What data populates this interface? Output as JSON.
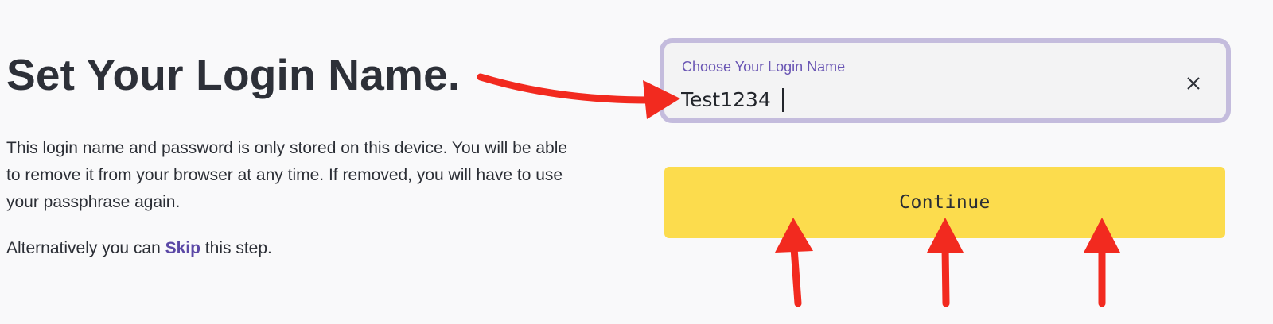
{
  "page": {
    "title": "Set Your Login Name.",
    "description": "This login name and password is only stored on this device. You will be able to remove it from your browser at any time. If removed, you will have to use your passphrase again.",
    "alternative": {
      "prefix": "Alternatively you can ",
      "link_label": "Skip",
      "suffix": " this step."
    }
  },
  "login_field": {
    "label": "Choose Your Login Name",
    "value": "Test1234",
    "clear_icon": "close-icon"
  },
  "continue_button": {
    "label": "Continue"
  },
  "annotations": {
    "arrow_color": "#f22a1f",
    "arrows": [
      "arrow-pointing-to-input",
      "arrow-pointing-to-continue-left",
      "arrow-pointing-to-continue-center",
      "arrow-pointing-to-continue-right"
    ]
  },
  "colors": {
    "background": "#f9f9fa",
    "accent": "#6a56b4",
    "link": "#5b48a6",
    "field_border": "#c4bcdd",
    "button": "#fcdc4d",
    "text": "#2b2e35"
  }
}
